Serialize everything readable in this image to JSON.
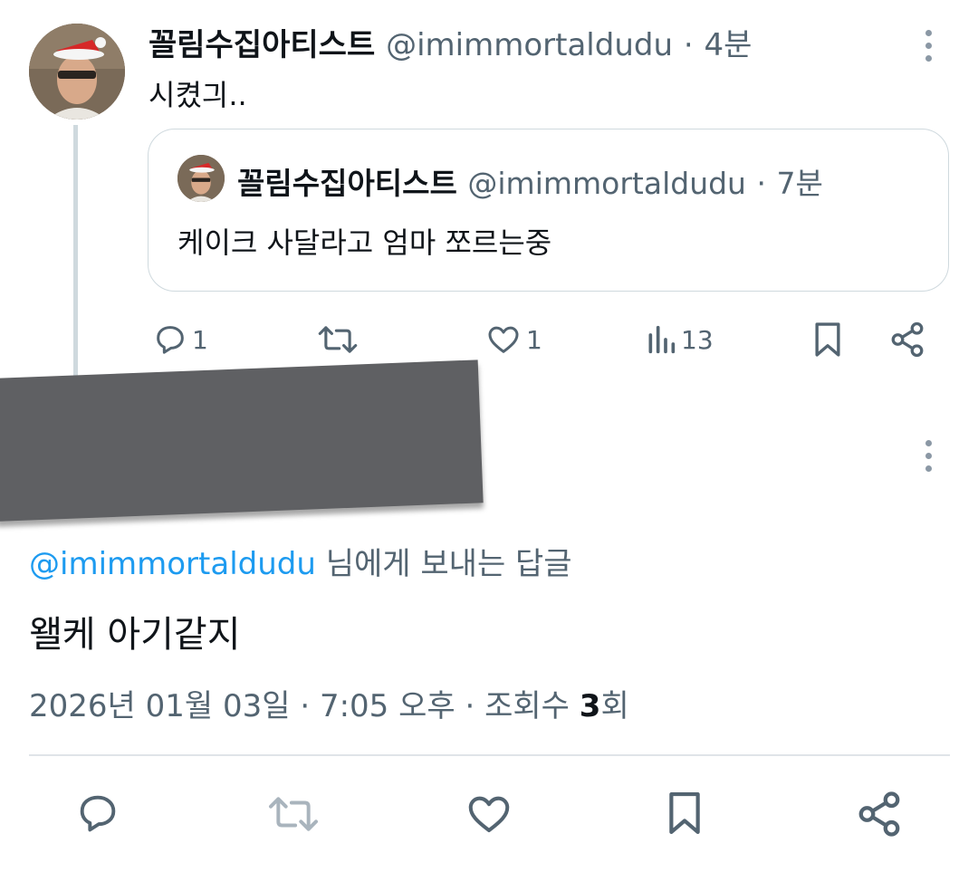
{
  "parent_tweet": {
    "author_name": "꼴림수집아티스트",
    "author_handle": "@imimmortaldudu",
    "separator": "·",
    "time": "4분",
    "text": "시켰긔..",
    "quoted_tweet": {
      "author_name": "꼴림수집아티스트",
      "author_handle": "@imimmortaldudu",
      "separator": "·",
      "time": "7분",
      "text": "케이크 사달라고 엄마 쪼르는중"
    },
    "actions": {
      "reply_count": "1",
      "like_count": "1",
      "views_count": "13"
    },
    "more_icon": "more-vertical-icon"
  },
  "reply_tweet": {
    "reply_to_mention": "@imimmortaldudu",
    "reply_to_suffix": "님에게 보내는 답글",
    "text": "왤케 아기같지",
    "date": "2026년 01월 03일",
    "separator": "·",
    "time": "7:05 오후",
    "views_label": "조회수",
    "views_count": "3",
    "views_unit": "회"
  },
  "colors": {
    "text_primary": "#0f1419",
    "text_secondary": "#536471",
    "link": "#1d9bf0",
    "border": "#cfd9de",
    "redaction": "#5f6063"
  }
}
